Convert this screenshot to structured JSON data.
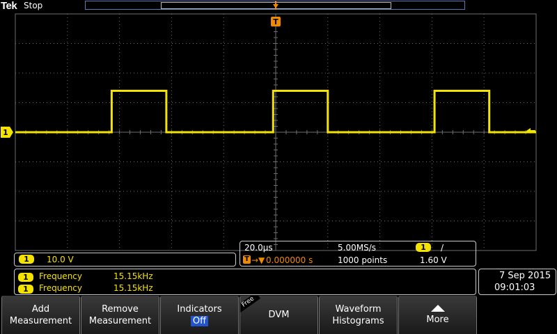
{
  "header": {
    "brand": "Tek",
    "status": "Stop"
  },
  "trigger_marker": "T",
  "channel_marker": "1",
  "channel": {
    "badge": "1",
    "scale": "10.0 V"
  },
  "acquisition": {
    "timebase": "20.0µs",
    "sample_rate": "5.00MS/s",
    "trigger_source_badge": "1",
    "trigger_slope": "/",
    "trigger_badge": "T",
    "trigger_arrow": "→▼",
    "trigger_position": "0.000000 s",
    "record_length": "1000 points",
    "trigger_level": "1.60 V"
  },
  "measurements": [
    {
      "badge": "1",
      "name": "Frequency",
      "value": "15.15kHz"
    },
    {
      "badge": "1",
      "name": "Frequency",
      "value": "15.15kHz"
    }
  ],
  "datetime": {
    "date": "7 Sep 2015",
    "time": "09:01:03"
  },
  "softkeys": [
    {
      "line1": "Add",
      "line2": "Measurement"
    },
    {
      "line1": "Remove",
      "line2": "Measurement"
    },
    {
      "line1": "Indicators",
      "line2": "Off"
    },
    {
      "tag": "Free",
      "line1": "DVM"
    },
    {
      "line1": "Waveform",
      "line2": "Histograms"
    },
    {
      "line1": "More"
    }
  ],
  "colors": {
    "ch1": "#f4e300",
    "trigger": "#f08a00",
    "grid": "#6e6e6e",
    "softkey_active": "#2255cc"
  },
  "chart_data": {
    "type": "line",
    "series": [
      {
        "x_div": [
          0,
          1.85,
          1.85,
          2.9,
          2.9,
          4.95,
          4.95,
          6.0,
          6.0,
          8.05,
          8.05,
          9.1,
          9.1,
          10
        ],
        "y_div": [
          0,
          0,
          1.4,
          1.4,
          0,
          0,
          1.4,
          1.4,
          0,
          0,
          1.4,
          1.4,
          0,
          0
        ]
      }
    ],
    "divisions": {
      "x": 10,
      "y": 8
    },
    "grid": true
  }
}
